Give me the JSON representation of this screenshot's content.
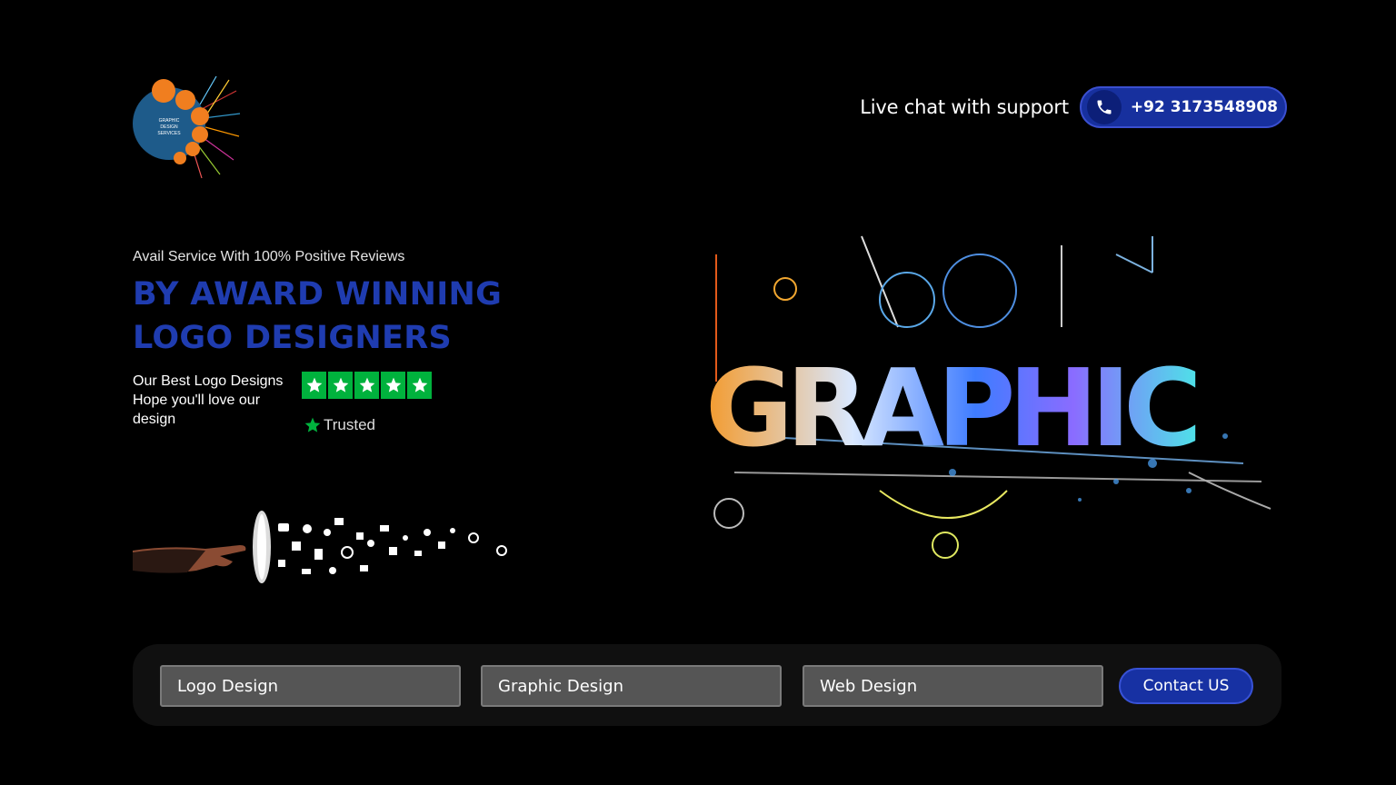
{
  "header": {
    "logo_icon": "graphic-design-services-logo",
    "logo_text": "GRAPHIC DESIGN SERVICES",
    "live_chat_label": "Live chat with support",
    "phone_icon": "phone-icon",
    "phone_number": "+92 3173548908"
  },
  "hero": {
    "subline": "Avail Service With 100% Positive Reviews",
    "headline_line1": "BY AWARD WINNING",
    "headline_line2": "LOGO DESIGNERS",
    "info_line1": "Our Best Logo Designs",
    "info_line2": "Hope you'll love our design",
    "rating_stars": 5,
    "trusted_label": "Trusted",
    "illustration_text": "GRAPHIC"
  },
  "services_bar": {
    "field1": "Logo Design",
    "field2": "Graphic Design",
    "field3": "Web Design",
    "contact_label": "Contact US"
  },
  "colors": {
    "headline": "#1f3cb0",
    "accent_button": "#1731a3",
    "star_green": "#00b23d",
    "logo_orange": "#f07e1f",
    "logo_blue": "#1e5b8a"
  }
}
